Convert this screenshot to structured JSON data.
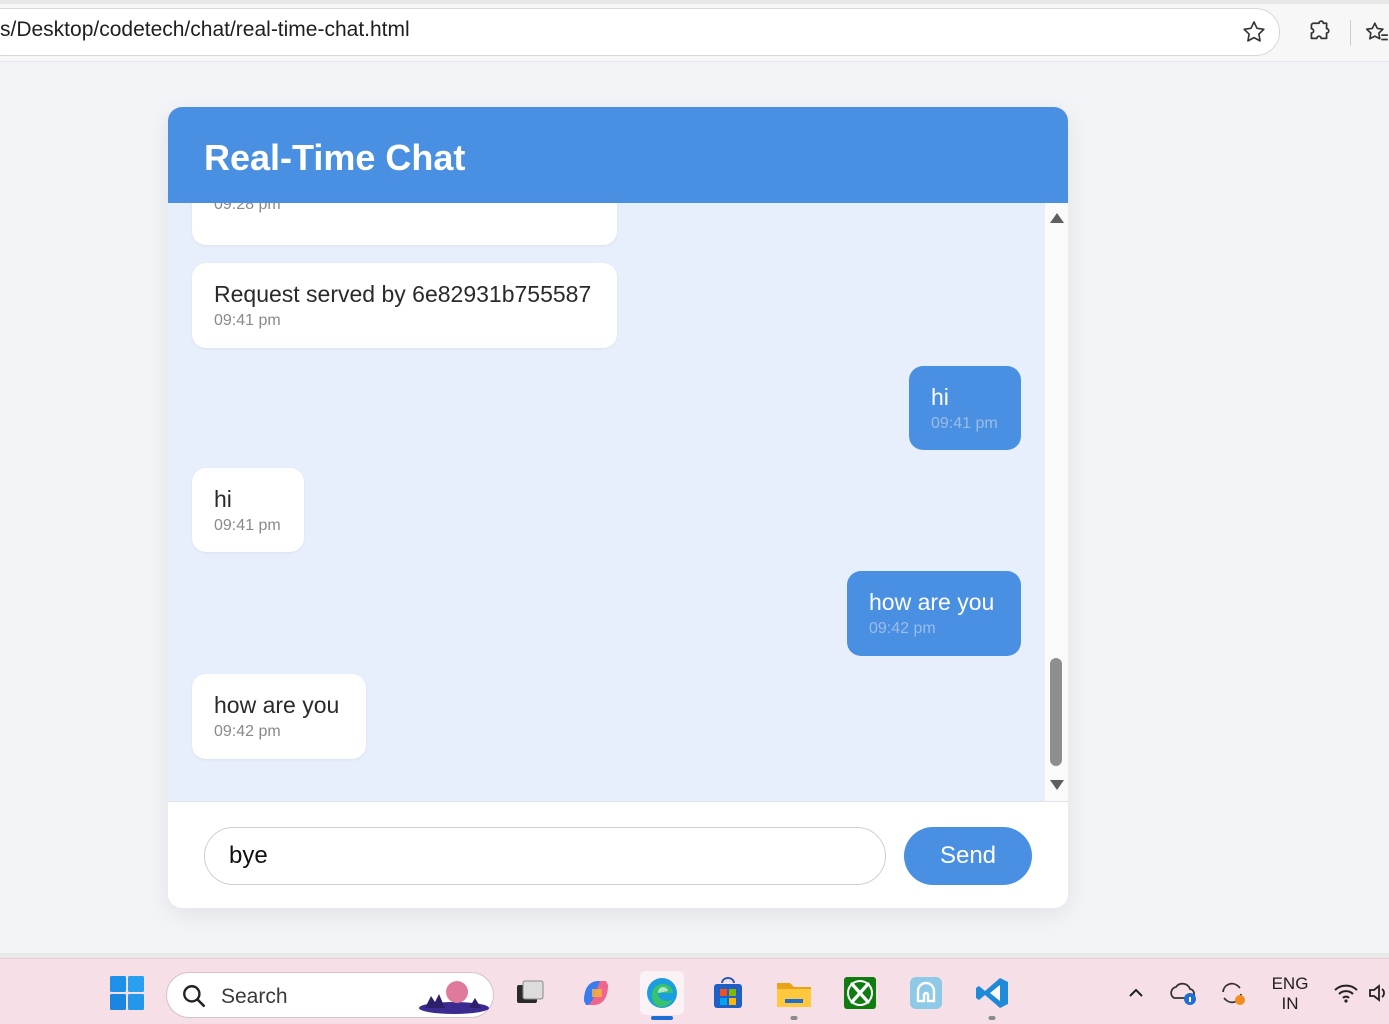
{
  "browser": {
    "url": "s/Desktop/codetech/chat/real-time-chat.html",
    "icons": [
      "star-icon",
      "extensions-icon",
      "favorites-icon"
    ]
  },
  "chat": {
    "title": "Real-Time Chat",
    "messages": [
      {
        "direction": "in",
        "text": "",
        "time": "09:28 pm"
      },
      {
        "direction": "in",
        "text": "Request served by 6e82931b755587",
        "time": "09:41 pm"
      },
      {
        "direction": "out",
        "text": "hi",
        "time": "09:41 pm"
      },
      {
        "direction": "in",
        "text": "hi",
        "time": "09:41 pm"
      },
      {
        "direction": "out",
        "text": "how are you",
        "time": "09:42 pm"
      },
      {
        "direction": "in",
        "text": "how are you",
        "time": "09:42 pm"
      }
    ],
    "input": {
      "value": "bye"
    },
    "send_label": "Send"
  },
  "colors": {
    "accent": "#4a90e2",
    "messages_bg": "#e8effc",
    "incoming_bubble": "#ffffff",
    "outgoing_bubble": "#4a90e2"
  },
  "taskbar": {
    "search_label": "Search",
    "language": {
      "line1": "ENG",
      "line2": "IN"
    },
    "apps": [
      "start-icon",
      "task-view-icon",
      "copilot-icon",
      "edge-icon",
      "store-icon",
      "file-explorer-icon",
      "xbox-icon",
      "app-icon",
      "vscode-icon"
    ],
    "tray": [
      "chevron-up-icon",
      "onedrive-icon",
      "sync-icon",
      "wifi-icon",
      "volume-icon"
    ]
  }
}
